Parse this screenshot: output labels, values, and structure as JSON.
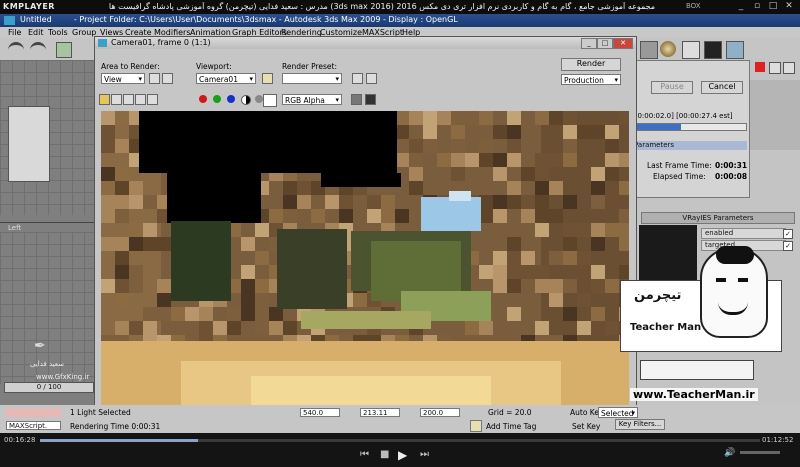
{
  "kmplayer": {
    "logo": "KMPLAYER",
    "title": "مجموعه آموزشی جامع ، گام به گام و کاربردی نرم افزار تری دی مکس 2016 (3ds max 2016) مدرس : سعید فدایی (تیچرمن) گروه آموزشی پادشاه گرافیست ها",
    "mode_label": "BOX",
    "time_current": "00:16:28",
    "time_total": "01:12:52",
    "controls": [
      "minimize",
      "restore",
      "maximize",
      "close"
    ]
  },
  "max": {
    "title_left": "Untitled",
    "title_main": "- Project Folder: C:\\Users\\User\\Documents\\3dsmax   - Autodesk 3ds Max  2009   - Display : OpenGL",
    "menu": [
      "File",
      "Edit",
      "Tools",
      "Group",
      "Views",
      "Create",
      "Modifiers",
      "Animation",
      "Graph Editors",
      "Rendering",
      "Customize",
      "MAXScript",
      "Help"
    ],
    "viewport_label": "Left",
    "time_slider": "0 / 100",
    "maxscript_label": "MAXScript.",
    "status": {
      "selected": "1 Light Selected",
      "rendering_time": "Rendering Time  0:00:31",
      "x_value": "540.0",
      "y_value": "213.11",
      "z_value": "200.0",
      "grid": "Grid = 20.0",
      "auto_key": "Auto Key",
      "selected_dd": "Selected",
      "set_key": "Set Key",
      "key_filters": "Key Filters...",
      "add_time_tag": "Add Time Tag"
    }
  },
  "render_dialog": {
    "title": "Camera01, frame 0 (1:1)",
    "area_label": "Area to Render:",
    "area_value": "View",
    "viewport_label": "Viewport:",
    "viewport_value": "Camera01",
    "preset_label": "Render Preset:",
    "preset_value": "",
    "render_button": "Render",
    "production_value": "Production",
    "channel_value": "RGB Alpha"
  },
  "progress": {
    "pause": "Pause",
    "cancel": "Cancel",
    "time_text": "00:00:02.0] [00:00:27.4 est]",
    "params_header": "Parameters",
    "last_frame_label": "Last Frame Time:",
    "last_frame_value": "0:00:31",
    "elapsed_label": "Elapsed Time:",
    "elapsed_value": "0:00:08",
    "progress_fraction": 0.42
  },
  "vray_panel": {
    "header": "VRayIES Parameters",
    "enabled": "enabled",
    "targeted": "targeted"
  },
  "watermarks": {
    "left_author": "سعید فدایی",
    "left_site": "www.GfxKing.ir",
    "teacherman_fa": "تیچرمن",
    "teacherman_en": "Teacher Man",
    "teacherman_site": "www.TeacherMan.ir"
  },
  "colors": {
    "max_title": "#1f4280",
    "render_bg": "#000000",
    "dialog_bg": "#c6c6c6"
  }
}
